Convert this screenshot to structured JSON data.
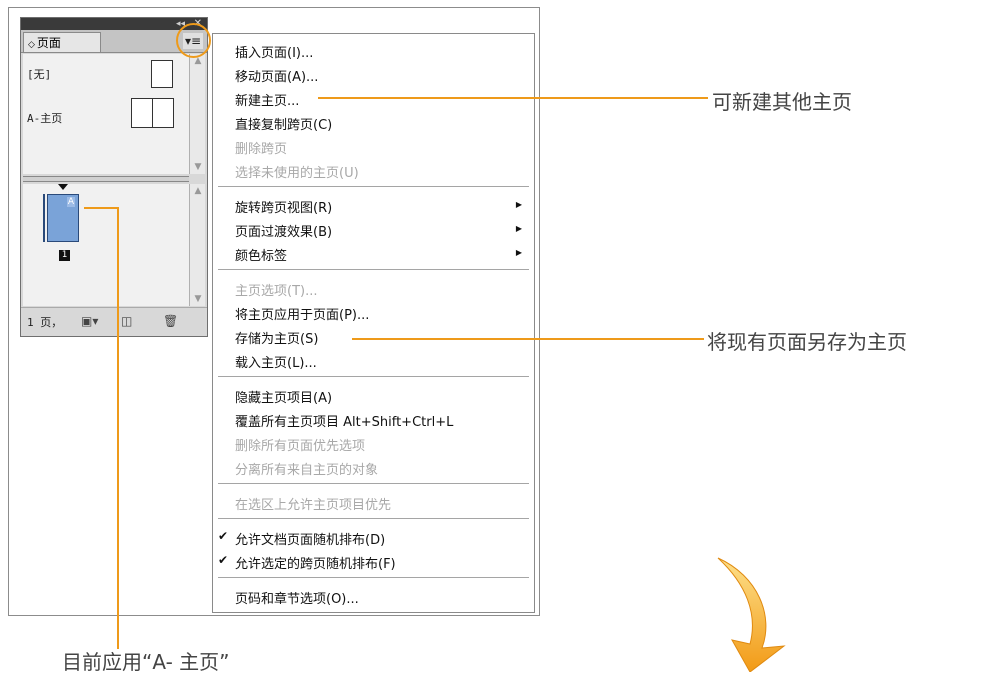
{
  "panel": {
    "tab_label": "页面",
    "tab_sort_glyph": "◇",
    "collapse_glyph": "◂◂",
    "close_glyph": "✕",
    "menu_button_glyph": "▾≡",
    "masters": [
      {
        "label": "[无]"
      },
      {
        "label": "A-主页"
      }
    ],
    "page_master_letter": "A",
    "page_number": "1",
    "page_count": "1 页，",
    "icons": [
      "new-page-icon",
      "new-spread-icon",
      "trash-icon"
    ]
  },
  "menu": {
    "items": [
      {
        "label": "插入页面(I)...",
        "enabled": true
      },
      {
        "label": "移动页面(A)...",
        "enabled": true
      },
      {
        "label": "新建主页...",
        "enabled": true
      },
      {
        "label": "直接复制跨页(C)",
        "enabled": true
      },
      {
        "label": "删除跨页",
        "enabled": false
      },
      {
        "label": "选择未使用的主页(U)",
        "enabled": false
      },
      {
        "label": "旋转跨页视图(R)",
        "enabled": true,
        "submenu": true
      },
      {
        "label": "页面过渡效果(B)",
        "enabled": true,
        "submenu": true
      },
      {
        "label": "颜色标签",
        "enabled": true,
        "submenu": true
      },
      {
        "label": "主页选项(T)...",
        "enabled": false
      },
      {
        "label": "将主页应用于页面(P)...",
        "enabled": true
      },
      {
        "label": "存储为主页(S)",
        "enabled": true
      },
      {
        "label": "载入主页(L)...",
        "enabled": true
      },
      {
        "label": "隐藏主页项目(A)",
        "enabled": true
      },
      {
        "label": "覆盖所有主页项目 Alt+Shift+Ctrl+L",
        "enabled": true
      },
      {
        "label": "删除所有页面优先选项",
        "enabled": false
      },
      {
        "label": "分离所有来自主页的对象",
        "enabled": false
      },
      {
        "label": "在选区上允许主页项目优先",
        "enabled": false
      },
      {
        "label": "允许文档页面随机排布(D)",
        "enabled": true,
        "checked": true
      },
      {
        "label": "允许选定的跨页随机排布(F)",
        "enabled": true,
        "checked": true
      },
      {
        "label": "页码和章节选项(O)...",
        "enabled": true
      }
    ],
    "submenu_glyph": "▶",
    "check_glyph": "✔"
  },
  "annotations": {
    "new_master": "可新建其他主页",
    "save_as_master": "将现有页面另存为主页",
    "current_applied": "目前应用“A- 主页”"
  },
  "colors": {
    "accent": "#ee9a1a",
    "panel_bg": "#d8d8d8",
    "page_blue": "#7aa3d8"
  }
}
